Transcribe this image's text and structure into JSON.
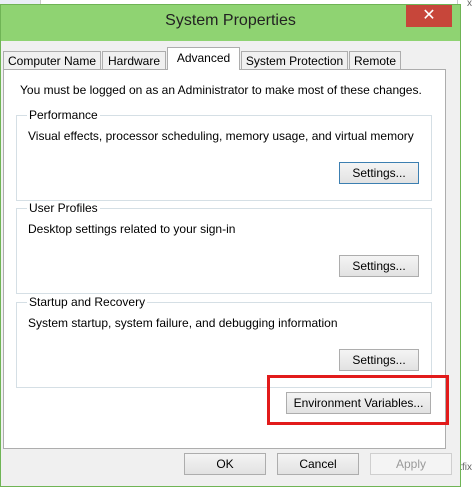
{
  "window": {
    "title": "System Properties",
    "close_glyph": "✕"
  },
  "tabs": [
    "Computer Name",
    "Hardware",
    "Advanced",
    "System Protection",
    "Remote"
  ],
  "admin_note": "You must be logged on as an Administrator to make most of these changes.",
  "performance": {
    "legend": "Performance",
    "description": "Visual effects, processor scheduling, memory usage, and virtual memory",
    "button": "Settings..."
  },
  "user_profiles": {
    "legend": "User Profiles",
    "description": "Desktop settings related to your sign-in",
    "button": "Settings..."
  },
  "startup_recovery": {
    "legend": "Startup and Recovery",
    "description": "System startup, system failure, and debugging information",
    "button": "Settings..."
  },
  "environment_button": "Environment Variables...",
  "footer": {
    "ok": "OK",
    "cancel": "Cancel",
    "apply": "Apply"
  },
  "colors": {
    "frame": "#8fd372",
    "close": "#c7463a",
    "highlight": "#e21b1b"
  },
  "icons": {
    "close": "close-icon"
  },
  "background": {
    "fragment_top": "x",
    "fragment_bottom": "Hotfix"
  }
}
